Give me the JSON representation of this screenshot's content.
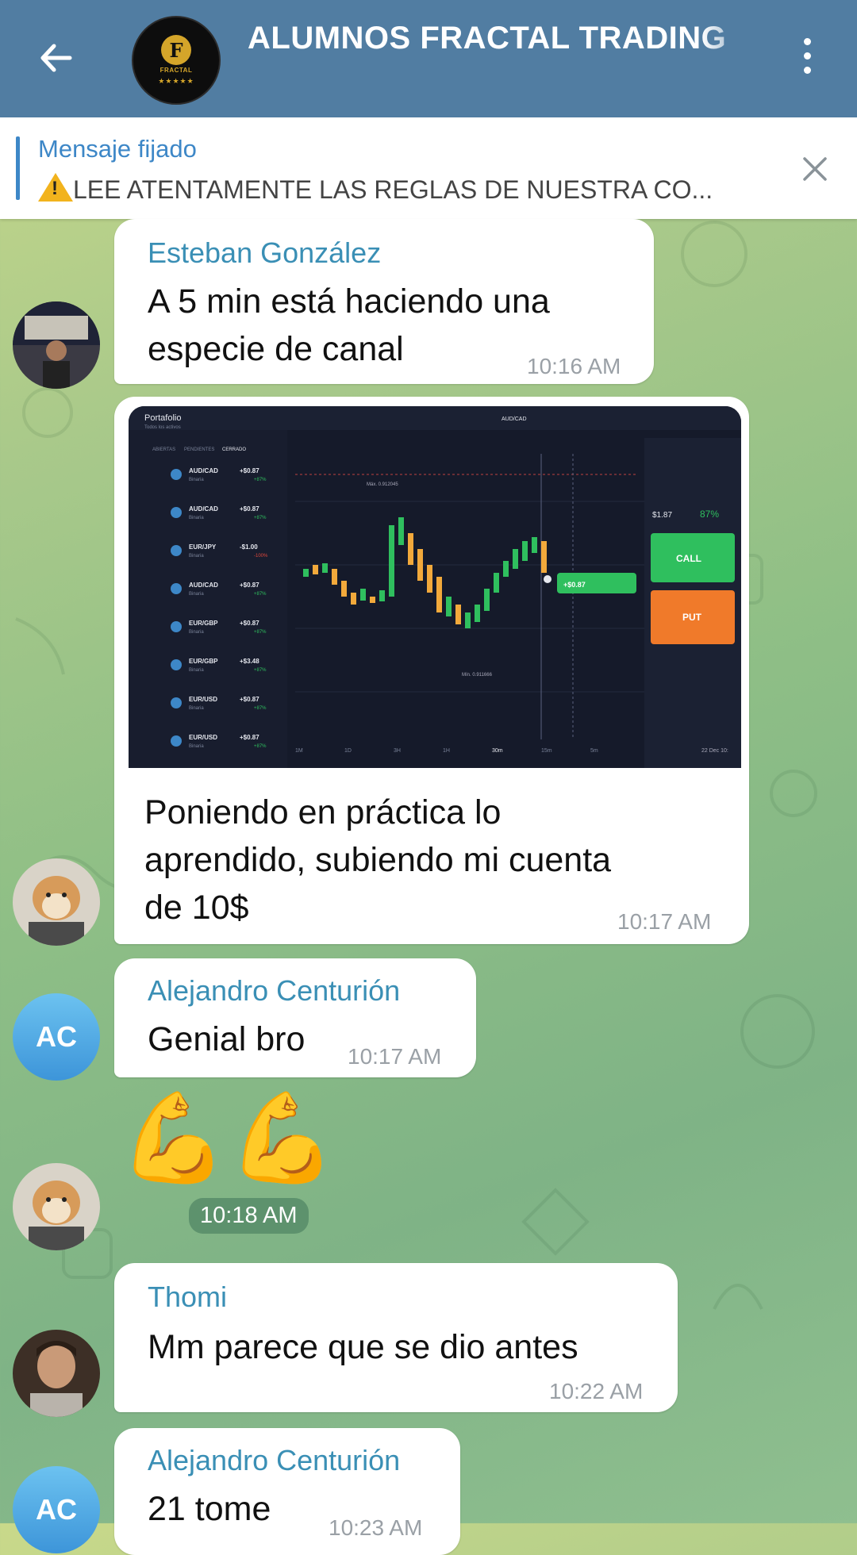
{
  "header": {
    "title": "ALUMNOS FRACTAL TRADING",
    "avatar_logo": "F",
    "avatar_label": "FRACTAL",
    "avatar_stars": "★★★★★"
  },
  "pinned": {
    "title": "Mensaje fijado",
    "text": "LEE ATENTAMENTE LAS REGLAS DE NUESTRA CO..."
  },
  "messages": [
    {
      "sender": "Esteban González",
      "lines": [
        "A 5 min está haciendo una",
        "especie de canal"
      ],
      "time": "10:16 AM"
    },
    {
      "caption_lines": [
        "Poniendo en práctica lo",
        "aprendido, subiendo mi cuenta",
        "de 10$"
      ],
      "time": "10:17 AM"
    },
    {
      "sender": "Alejandro Centurión",
      "avatar_initials": "AC",
      "text": "Genial bro",
      "time": "10:17 AM"
    },
    {
      "emoji": "💪💪",
      "time": "10:18 AM"
    },
    {
      "sender": "Thomi",
      "text": "Mm parece que se dio antes",
      "time": "10:22 AM"
    },
    {
      "sender": "Alejandro Centurión",
      "avatar_initials": "AC",
      "text": "21 tome",
      "time": "10:23 AM"
    }
  ],
  "trading_screenshot": {
    "title": "Portafolio",
    "subtitle": "Todos los activos",
    "tabs": [
      "ABIERTAS",
      "PENDIENTES",
      "CERRADO"
    ],
    "assets": [
      {
        "pair": "AUD/CAD",
        "type": "Binaria",
        "change": "+$0.87",
        "pct": "+87%"
      },
      {
        "pair": "AUD/CAD",
        "type": "Binaria",
        "change": "+$0.87",
        "pct": "+87%"
      },
      {
        "pair": "EUR/JPY",
        "type": "Binaria",
        "change": "-$1.00",
        "pct": "-100%"
      },
      {
        "pair": "AUD/CAD",
        "type": "Binaria",
        "change": "+$0.87",
        "pct": "+87%"
      },
      {
        "pair": "EUR/GBP",
        "type": "Binaria",
        "change": "+$0.87",
        "pct": "+87%"
      },
      {
        "pair": "EUR/GBP",
        "type": "Binaria",
        "change": "+$3.48",
        "pct": "+87%"
      },
      {
        "pair": "EUR/USD",
        "type": "Binaria",
        "change": "+$0.87",
        "pct": "+87%"
      },
      {
        "pair": "EUR/USD",
        "type": "Binaria",
        "change": "+$0.87",
        "pct": "+87%"
      }
    ],
    "call_label": "CALL",
    "put_label": "PUT",
    "payout": "$1.87",
    "payout_pct": "87%",
    "max_label": "Máx. 0.912045",
    "min_label": "Mín. 0.911666",
    "trade_badge": "+$0.87",
    "timeframes": [
      "1M",
      "1D",
      "3H",
      "1H",
      "30m",
      "15m",
      "5m"
    ],
    "date_label": "22 Dec 10:"
  },
  "colors": {
    "header_bg": "#517da2",
    "accent": "#3a8fb5",
    "call": "#2fbf5e",
    "put": "#f07a2a"
  }
}
